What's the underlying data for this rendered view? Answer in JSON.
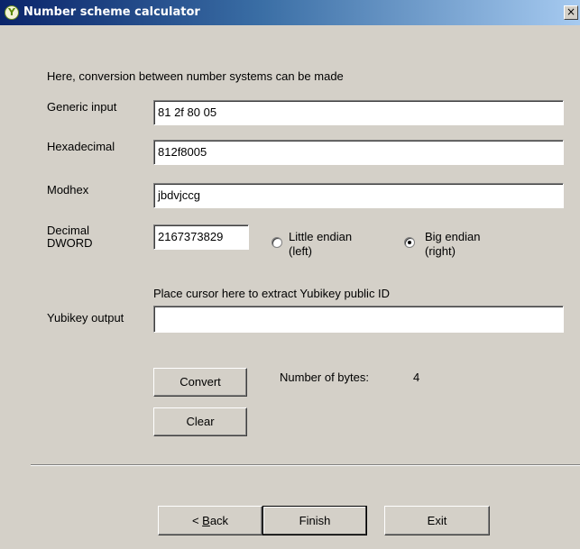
{
  "window": {
    "title": "Number scheme calculator",
    "app_icon_glyph": "Y",
    "close_glyph": "×"
  },
  "intro": "Here, conversion between number systems can be made",
  "fields": {
    "generic": {
      "label": "Generic input",
      "value": "81 2f 80 05"
    },
    "hex": {
      "label": "Hexadecimal",
      "value": "812f8005"
    },
    "modhex": {
      "label": "Modhex",
      "value": "jbdvjccg"
    },
    "decimal": {
      "label_line1": "Decimal",
      "label_line2": "DWORD",
      "value": "2167373829"
    }
  },
  "endian": {
    "little": {
      "line1": "Little endian",
      "line2": "(left)",
      "selected": false
    },
    "big": {
      "line1": "Big endian",
      "line2": "(right)",
      "selected": true
    }
  },
  "yubikey": {
    "hint": "Place cursor here to extract Yubikey public ID",
    "label": "Yubikey output",
    "value": ""
  },
  "bytes": {
    "label": "Number of bytes:",
    "value": "4"
  },
  "buttons": {
    "convert": "Convert",
    "clear": "Clear",
    "back_mnemonic": "B",
    "back_rest": "ack",
    "back_prefix": "< ",
    "finish": "Finish",
    "exit": "Exit"
  }
}
